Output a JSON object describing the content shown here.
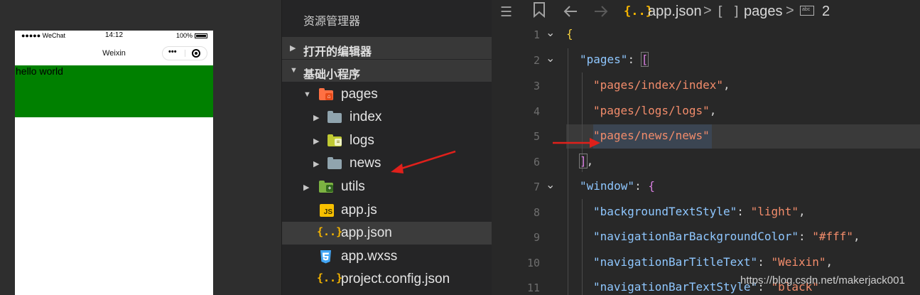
{
  "simulator": {
    "status": {
      "carrier": "●●●●● WeChat",
      "time": "14:12",
      "battery": "100%"
    },
    "nav_title": "Weixin",
    "capsule_dots": "•••",
    "content_text": "hello world",
    "colors": {
      "view_background": "#008000"
    }
  },
  "explorer": {
    "title": "资源管理器",
    "sections": [
      {
        "label": "打开的编辑器",
        "expanded": false
      },
      {
        "label": "基础小程序",
        "expanded": true
      }
    ],
    "tree": [
      {
        "label": "pages",
        "icon": "pages-folder-icon",
        "twisty": "▼"
      },
      {
        "label": "index",
        "icon": "folder-icon",
        "twisty": "▶"
      },
      {
        "label": "logs",
        "icon": "logs-folder-icon",
        "twisty": "▶"
      },
      {
        "label": "news",
        "icon": "folder-icon",
        "twisty": "▶"
      },
      {
        "label": "utils",
        "icon": "utils-folder-icon",
        "twisty": "▶"
      },
      {
        "label": "app.js",
        "icon": "js-file-icon",
        "badge": "JS"
      },
      {
        "label": "app.json",
        "icon": "json-file-icon",
        "badge": "{..}",
        "selected": true
      },
      {
        "label": "app.wxss",
        "icon": "css-file-icon"
      },
      {
        "label": "project.config.json",
        "icon": "json-file-icon",
        "badge": "{..}"
      }
    ]
  },
  "editor": {
    "breadcrumb": {
      "file_icon": "{..}",
      "file": "app.json",
      "sep": ">",
      "array_icon": "[ ]",
      "node": "pages",
      "abc_icon": "abc",
      "count": "2"
    },
    "lines": [
      {
        "n": "1",
        "fold": "⌄"
      },
      {
        "n": "2",
        "fold": "⌄"
      },
      {
        "n": "3"
      },
      {
        "n": "4"
      },
      {
        "n": "5"
      },
      {
        "n": "6"
      },
      {
        "n": "7",
        "fold": "⌄"
      },
      {
        "n": "8"
      },
      {
        "n": "9"
      },
      {
        "n": "10"
      },
      {
        "n": "11"
      }
    ],
    "code": {
      "l1": "{",
      "l2_key": "\"pages\"",
      "l2_punct": ": ",
      "l2_bracket": "[",
      "l3_str": "\"pages/index/index\"",
      "l3_punct": ",",
      "l4_str": "\"pages/logs/logs\"",
      "l4_punct": ",",
      "l5_str": "\"pages/news/news\"",
      "l6_bracket": "]",
      "l6_punct": ",",
      "l7_key": "\"window\"",
      "l7_punct": ": ",
      "l7_brace": "{",
      "l8_key": "\"backgroundTextStyle\"",
      "l8_punct": ": ",
      "l8_str": "\"light\"",
      "l8_tail": ",",
      "l9_key": "\"navigationBarBackgroundColor\"",
      "l9_punct": ": ",
      "l9_str": "\"#fff\"",
      "l9_tail": ",",
      "l10_key": "\"navigationBarTitleText\"",
      "l10_punct": ": ",
      "l10_str": "\"Weixin\"",
      "l10_tail": ",",
      "l11_key": "\"navigationBarTextStyle\"",
      "l11_punct": ": ",
      "l11_str": "\"black\""
    }
  },
  "watermark": "https://blog.csdn.net/makerjack001",
  "colors": {
    "annotation_arrow": "#e0201b",
    "json_key": "#8fc7ff",
    "json_string": "#f28c6b"
  }
}
